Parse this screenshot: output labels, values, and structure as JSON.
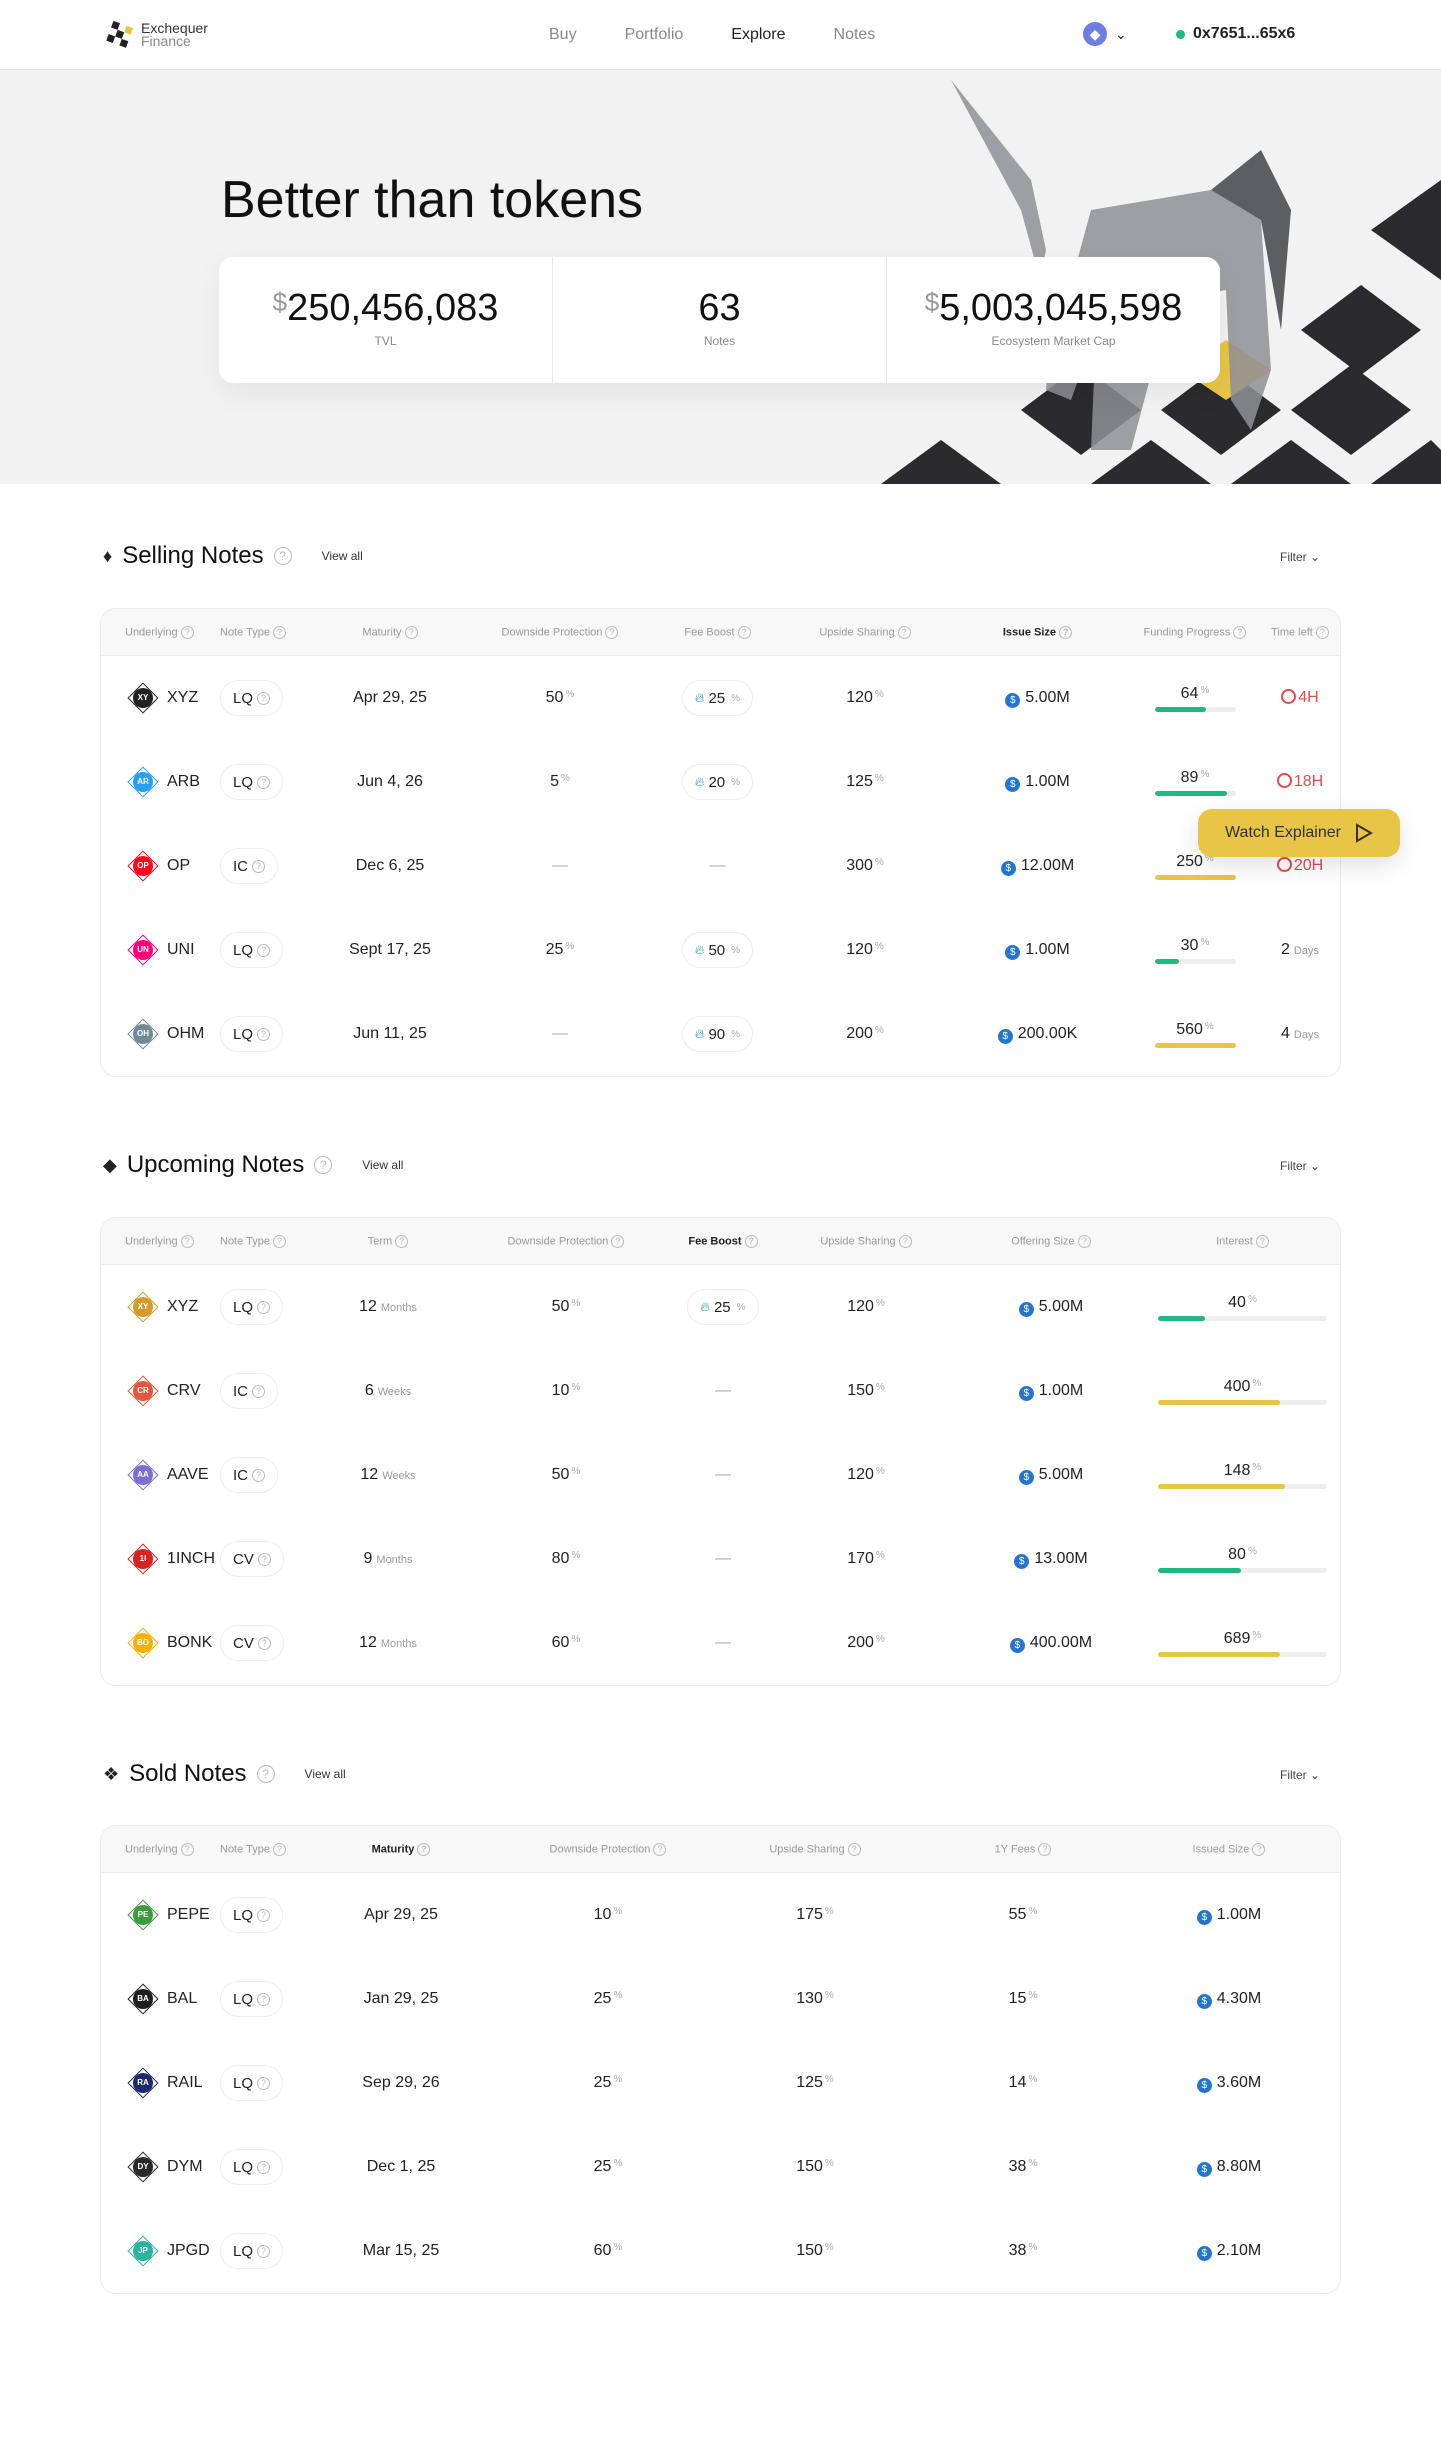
{
  "brand": {
    "name_line1": "Exchequer",
    "name_line2": "Finance"
  },
  "nav": {
    "items": [
      "Buy",
      "Portfolio",
      "Explore",
      "Notes"
    ],
    "active": "Explore",
    "wallet": "0x7651...65x6",
    "network_icon": "ethereum-icon"
  },
  "hero": {
    "title": "Better than tokens",
    "stats": [
      {
        "prefix": "$",
        "value": "250,456,083",
        "label": "TVL"
      },
      {
        "prefix": "",
        "value": "63",
        "label": "Notes"
      },
      {
        "prefix": "$",
        "value": "5,003,045,598",
        "label": "Ecosystem Market Cap"
      }
    ]
  },
  "watch_explainer": "Watch Explainer",
  "colors": {
    "green": "#1db97f",
    "yellow": "#e8c447",
    "urgent": "#e24b4b",
    "usdc": "#2775ca"
  },
  "sections": [
    {
      "title": "Selling Notes",
      "view_all": "View all",
      "filter": "Filter",
      "columns": [
        {
          "label": "Underlying",
          "kind": "token"
        },
        {
          "label": "Note Type",
          "kind": "type"
        },
        {
          "label": "Maturity",
          "kind": "text"
        },
        {
          "label": "Downside Protection",
          "kind": "pct"
        },
        {
          "label": "Fee Boost",
          "kind": "fee"
        },
        {
          "label": "Upside Sharing",
          "kind": "pct"
        },
        {
          "label": "Issue Size",
          "kind": "size",
          "strong": true
        },
        {
          "label": "Funding Progress",
          "kind": "prog"
        },
        {
          "label": "Time left",
          "kind": "time"
        }
      ],
      "rows": [
        {
          "cells": [
            "XYZ",
            "LQ",
            "Apr 29, 25",
            "50",
            "25",
            "120",
            "5.00M",
            "64",
            "4H"
          ],
          "bar_fill": 0.64,
          "time_urgent": true,
          "color": "#222"
        },
        {
          "cells": [
            "ARB",
            "LQ",
            "Jun 4, 26",
            "5",
            "20",
            "125",
            "1.00M",
            "89",
            "18H"
          ],
          "bar_fill": 0.89,
          "time_urgent": true,
          "color": "#28a0f0"
        },
        {
          "cells": [
            "OP",
            "IC",
            "Dec 6, 25",
            "—",
            "—",
            "300",
            "12.00M",
            "250",
            "20H"
          ],
          "bar_fill": 1,
          "time_urgent": true,
          "color": "#ff0420"
        },
        {
          "cells": [
            "UNI",
            "LQ",
            "Sept 17, 25",
            "25",
            "50",
            "120",
            "1.00M",
            "30",
            "2"
          ],
          "time_unit": "Days",
          "bar_fill": 0.3,
          "color": "#ff007a"
        },
        {
          "cells": [
            "OHM",
            "LQ",
            "Jun 11, 25",
            "—",
            "90",
            "200",
            "200.00K",
            "560",
            "4"
          ],
          "time_unit": "Days",
          "bar_fill": 1,
          "color": "#708b96"
        }
      ]
    },
    {
      "title": "Upcoming Notes",
      "view_all": "View all",
      "filter": "Filter",
      "columns": [
        {
          "label": "Underlying",
          "kind": "token"
        },
        {
          "label": "Note Type",
          "kind": "type"
        },
        {
          "label": "Term",
          "kind": "term"
        },
        {
          "label": "Downside Protection",
          "kind": "pct"
        },
        {
          "label": "Fee Boost",
          "kind": "fee",
          "strong": true
        },
        {
          "label": "Upside Sharing",
          "kind": "pct"
        },
        {
          "label": "Offering Size",
          "kind": "size"
        },
        {
          "label": "Interest",
          "kind": "wideprog"
        }
      ],
      "rows": [
        {
          "cells": [
            "XYZ",
            "LQ",
            "12",
            "50",
            "25",
            "120",
            "5.00M",
            "40"
          ],
          "term_unit": "Months",
          "bar_fill": 0.28,
          "color": "#d49a2a"
        },
        {
          "cells": [
            "CRV",
            "IC",
            "6",
            "10",
            "—",
            "150",
            "1.00M",
            "400"
          ],
          "term_unit": "Weeks",
          "bar_fill": 0.72,
          "color": "#e8553e"
        },
        {
          "cells": [
            "AAVE",
            "IC",
            "12",
            "50",
            "—",
            "120",
            "5.00M",
            "148"
          ],
          "term_unit": "Weeks",
          "bar_fill": 0.75,
          "color": "#7a6fd0"
        },
        {
          "cells": [
            "1INCH",
            "CV",
            "9",
            "80",
            "—",
            "170",
            "13.00M",
            "80"
          ],
          "term_unit": "Months",
          "bar_fill": 0.49,
          "color": "#d82122"
        },
        {
          "cells": [
            "BONK",
            "CV",
            "12",
            "60",
            "—",
            "200",
            "400.00M",
            "689"
          ],
          "term_unit": "Months",
          "bar_fill": 0.72,
          "color": "#f5b100"
        }
      ]
    },
    {
      "title": "Sold Notes",
      "view_all": "View all",
      "filter": "Filter",
      "columns": [
        {
          "label": "Underlying",
          "kind": "token"
        },
        {
          "label": "Note Type",
          "kind": "type"
        },
        {
          "label": "Maturity",
          "kind": "text",
          "strong": true
        },
        {
          "label": "Downside Protection",
          "kind": "pct"
        },
        {
          "label": "Upside Sharing",
          "kind": "pct"
        },
        {
          "label": "1Y Fees",
          "kind": "pct"
        },
        {
          "label": "Issued Size",
          "kind": "size"
        }
      ],
      "rows": [
        {
          "cells": [
            "PEPE",
            "LQ",
            "Apr 29, 25",
            "10",
            "175",
            "55",
            "1.00M"
          ],
          "color": "#3d9a3d"
        },
        {
          "cells": [
            "BAL",
            "LQ",
            "Jan 29, 25",
            "25",
            "130",
            "15",
            "4.30M"
          ],
          "color": "#1e1e1e"
        },
        {
          "cells": [
            "RAIL",
            "LQ",
            "Sep 29, 26",
            "25",
            "125",
            "14",
            "3.60M"
          ],
          "color": "#1d2a6b"
        },
        {
          "cells": [
            "DYM",
            "LQ",
            "Dec 1, 25",
            "25",
            "150",
            "38",
            "8.80M"
          ],
          "color": "#2a2a2a"
        },
        {
          "cells": [
            "JPGD",
            "LQ",
            "Mar 15, 25",
            "60",
            "150",
            "38",
            "2.10M"
          ],
          "color": "#2bb3a0"
        }
      ]
    }
  ]
}
